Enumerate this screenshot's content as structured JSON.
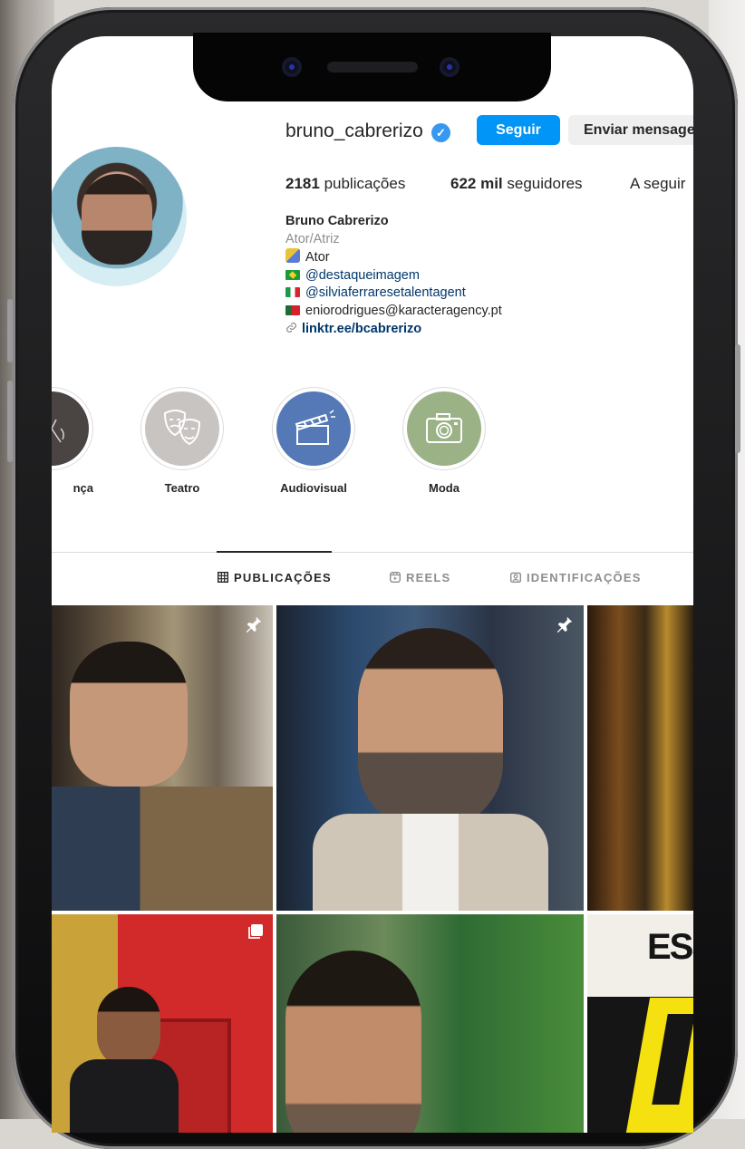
{
  "profile": {
    "username": "bruno_cabrerizo",
    "follow_label": "Seguir",
    "message_label": "Enviar mensagem",
    "stats": {
      "posts_count": "2181",
      "posts_label": "publicações",
      "followers_count": "622 mil",
      "followers_label": "seguidores",
      "following_label": "A seguir"
    },
    "bio": {
      "name": "Bruno Cabrerizo",
      "category": "Ator/Atriz",
      "line1": "Ator",
      "line2": "@destaqueimagem",
      "line3": "@silviaferraresetalentagent",
      "line4": "eniorodrigues@karacteragency.pt",
      "link": "linktr.ee/bcabrerizo"
    }
  },
  "highlights": [
    {
      "label": "nça",
      "color": "#4a4543"
    },
    {
      "label": "Teatro",
      "color": "#c8c4c1"
    },
    {
      "label": "Audiovisual",
      "color": "#5479b6"
    },
    {
      "label": "Moda",
      "color": "#9bb286"
    }
  ],
  "tabs": [
    {
      "label": "PUBLICAÇÕES",
      "active": true,
      "icon": "grid-icon"
    },
    {
      "label": "REELS",
      "active": false,
      "icon": "reels-icon"
    },
    {
      "label": "IDENTIFICAÇÕES",
      "active": false,
      "icon": "tagged-icon"
    }
  ],
  "posts_overlay_text": {
    "post6": "ESS"
  },
  "colors": {
    "primary_button": "#0095f6",
    "verified": "#3897f0",
    "link": "#00376b"
  }
}
